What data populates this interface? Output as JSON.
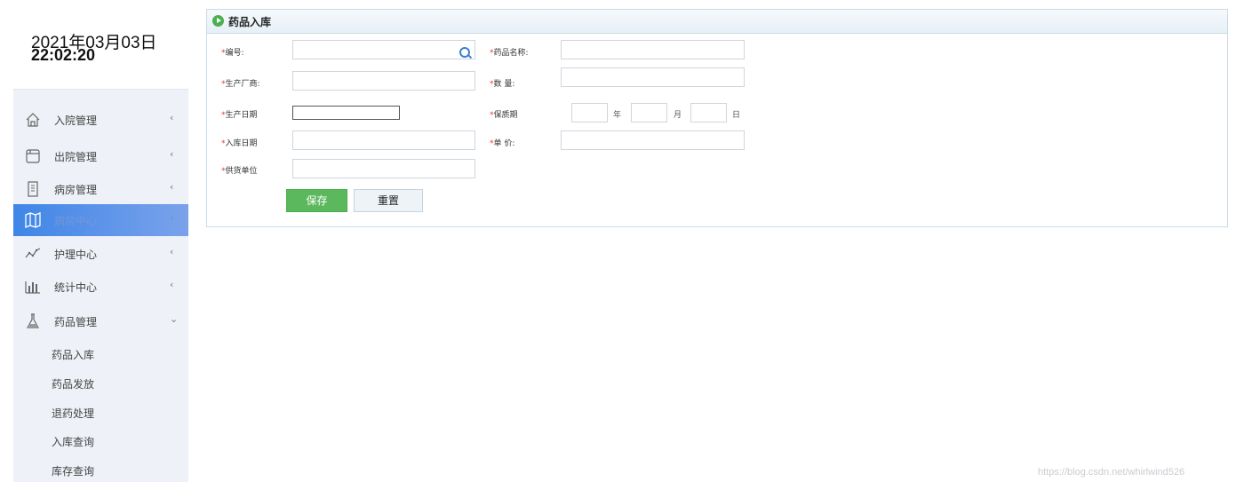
{
  "clock": {
    "date": "2021年03月03日",
    "time": "22:02:20"
  },
  "sidebar": {
    "items": [
      {
        "label": "入院管理",
        "icon": "home-icon",
        "chevron": "‹"
      },
      {
        "label": "出院管理",
        "icon": "window-icon",
        "chevron": "‹"
      },
      {
        "label": "病房管理",
        "icon": "building-icon",
        "chevron": "‹"
      },
      {
        "label": "病房中心",
        "icon": "map-icon",
        "chevron": "‹"
      },
      {
        "label": "护理中心",
        "icon": "trend-icon",
        "chevron": "‹"
      },
      {
        "label": "统计中心",
        "icon": "bar-chart-icon",
        "chevron": "‹"
      },
      {
        "label": "药品管理",
        "icon": "flask-icon",
        "chevron": "⌄"
      }
    ],
    "subitems": [
      "药品入库",
      "药品发放",
      "退药处理",
      "入库查询",
      "库存查询"
    ]
  },
  "panel": {
    "title": "药品入库"
  },
  "form": {
    "required_mark": "*",
    "code_label": "编号:",
    "name_label": "药品名称:",
    "maker_label": "生产厂商:",
    "qty_label": "数  量:",
    "prod_date_label": "生产日期",
    "shelf_label": "保质期",
    "in_date_label": "入库日期",
    "price_label": "单  价:",
    "supplier_label": "供货单位",
    "unit_year": "年",
    "unit_month": "月",
    "unit_day": "日",
    "save_label": "保存",
    "reset_label": "重置"
  },
  "watermark": "https://blog.csdn.net/whirlwind526",
  "colors": {
    "accent": "#3f86e8",
    "save": "#5cb85c",
    "required": "#e4393c"
  }
}
